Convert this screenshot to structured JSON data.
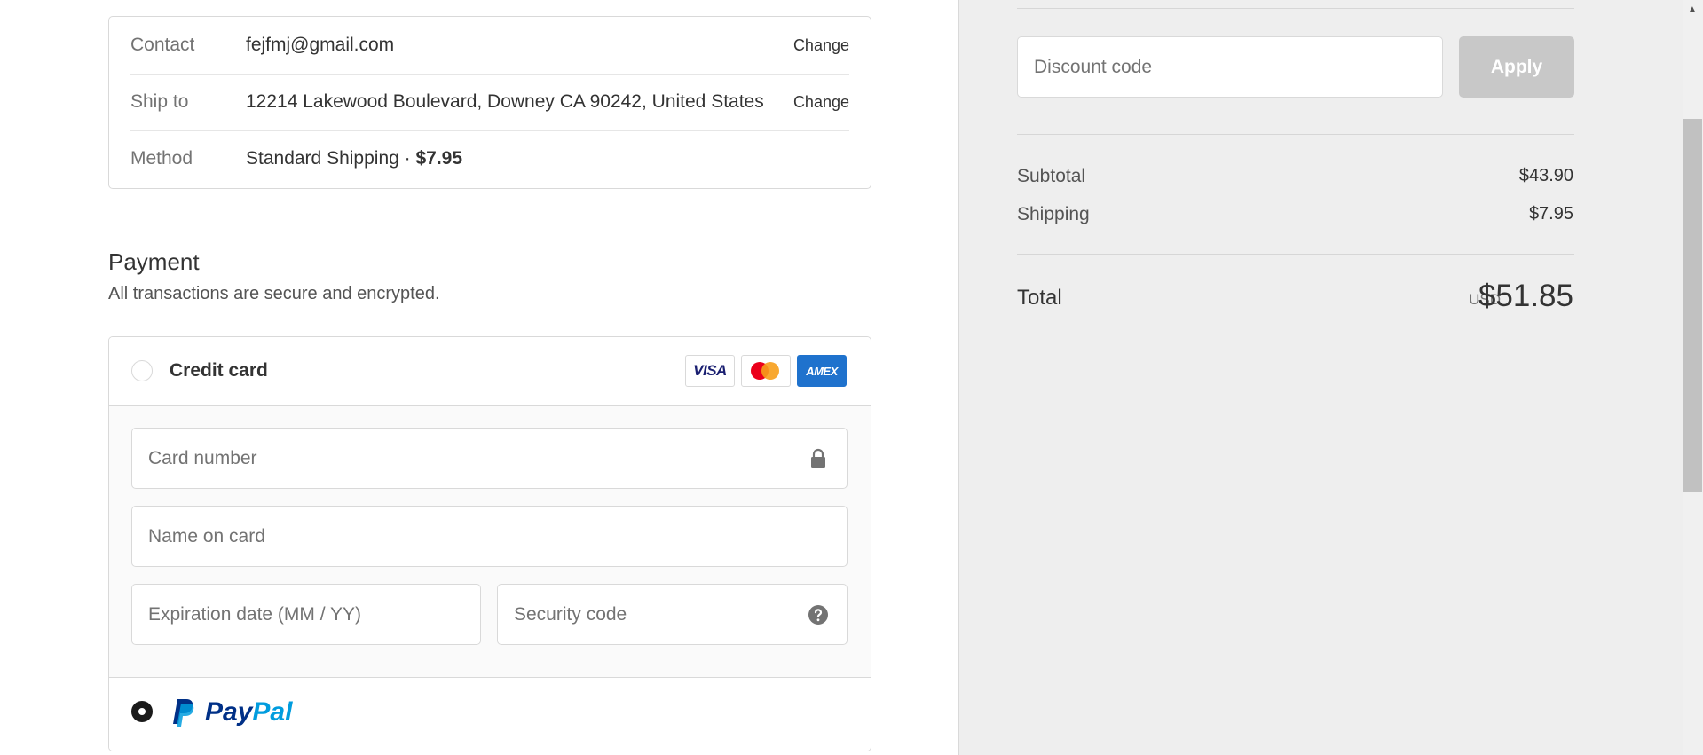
{
  "review": {
    "contact_label": "Contact",
    "contact_value": "fejfmj@gmail.com",
    "contact_change": "Change",
    "ship_label": "Ship to",
    "ship_value": "12214 Lakewood Boulevard, Downey CA 90242, United States",
    "ship_change": "Change",
    "method_label": "Method",
    "method_name": "Standard Shipping · ",
    "method_price": "$7.95"
  },
  "payment": {
    "title": "Payment",
    "subtitle": "All transactions are secure and encrypted.",
    "credit_card_label": "Credit card",
    "credit_card_selected": false,
    "card_brands": [
      "VISA",
      "mastercard",
      "AMEX"
    ],
    "card_number_placeholder": "Card number",
    "name_placeholder": "Name on card",
    "expiration_placeholder": "Expiration date (MM / YY)",
    "security_placeholder": "Security code",
    "paypal_selected": true,
    "paypal_label_pay": "Pay",
    "paypal_label_pal": "Pal"
  },
  "summary": {
    "discount_placeholder": "Discount code",
    "apply_label": "Apply",
    "subtotal_label": "Subtotal",
    "subtotal_value": "$43.90",
    "shipping_label": "Shipping",
    "shipping_value": "$7.95",
    "total_label": "Total",
    "currency": "USD",
    "total_value": "$51.85"
  },
  "colors": {
    "paypal_dark": "#003087",
    "paypal_light": "#009cde",
    "amex": "#1f72cd",
    "apply_disabled": "#c8c8c8"
  },
  "icons": [
    "lock-icon",
    "help-icon",
    "paypal-logo-icon",
    "visa-icon",
    "mastercard-icon",
    "amex-icon"
  ]
}
